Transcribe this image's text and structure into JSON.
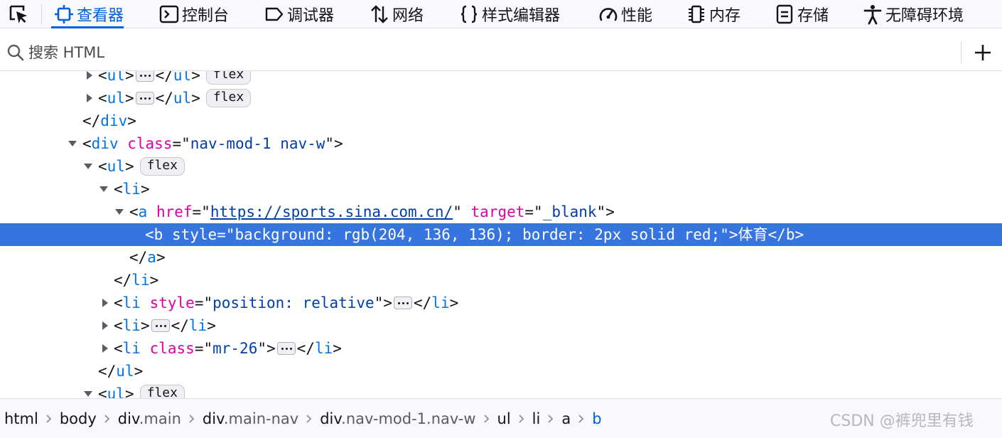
{
  "toolbar": {
    "tabs": [
      {
        "label": "查看器",
        "icon": "inspector-icon",
        "selected": true
      },
      {
        "label": "控制台",
        "icon": "console-icon"
      },
      {
        "label": "调试器",
        "icon": "debugger-icon"
      },
      {
        "label": "网络",
        "icon": "network-icon"
      },
      {
        "label": "样式编辑器",
        "icon": "style-editor-icon"
      },
      {
        "label": "性能",
        "icon": "performance-icon"
      },
      {
        "label": "内存",
        "icon": "memory-icon"
      },
      {
        "label": "存储",
        "icon": "storage-icon"
      },
      {
        "label": "无障碍环境",
        "icon": "accessibility-icon"
      }
    ]
  },
  "search": {
    "placeholder": "搜索 HTML"
  },
  "markup": {
    "badge_flex": "flex",
    "rows": [
      {
        "expanded": false,
        "parts": [
          "<",
          "ul",
          ">",
          "</",
          "ul",
          ">"
        ]
      },
      {
        "expanded": false,
        "parts": [
          "<",
          "ul",
          ">",
          "</",
          "ul",
          ">"
        ]
      },
      {
        "parts": [
          "</",
          "div",
          ">"
        ]
      },
      {
        "expanded": true,
        "parts": [
          "<",
          "div",
          "class",
          "=\"",
          "nav-mod-1 nav-w",
          "\">"
        ]
      },
      {
        "expanded": true,
        "parts": [
          "<",
          "ul",
          ">"
        ]
      },
      {
        "expanded": true,
        "parts": [
          "<",
          "li",
          ">"
        ]
      },
      {
        "expanded": true,
        "parts": [
          "<",
          "a",
          "href",
          "=\"",
          "https://sports.sina.com.cn/",
          "\"",
          "target",
          "=\"",
          "_blank",
          "\">"
        ]
      },
      {
        "selected": true,
        "parts": [
          "<",
          "b",
          "style",
          "=\"",
          "background: rgb(204, 136, 136); border: 2px solid red;",
          "\">",
          "体育",
          "</",
          "b",
          ">"
        ]
      },
      {
        "parts": [
          "</",
          "a",
          ">"
        ]
      },
      {
        "parts": [
          "</",
          "li",
          ">"
        ]
      },
      {
        "expanded": false,
        "parts": [
          "<",
          "li",
          "style",
          "=\"",
          "position: relative",
          "\">",
          "</",
          "li",
          ">"
        ]
      },
      {
        "expanded": false,
        "parts": [
          "<",
          "li",
          ">",
          "</",
          "li",
          ">"
        ]
      },
      {
        "expanded": false,
        "parts": [
          "<",
          "li",
          "class",
          "=\"",
          "mr-26",
          "\">",
          "</",
          "li",
          ">"
        ]
      },
      {
        "parts": [
          "</",
          "ul",
          ">"
        ]
      },
      {
        "expanded": true,
        "parts": [
          "<",
          "ul",
          ">"
        ]
      }
    ]
  },
  "breadcrumbs": [
    {
      "tag": "html"
    },
    {
      "tag": "body"
    },
    {
      "tag": "div",
      "cls": ".main"
    },
    {
      "tag": "div",
      "cls": ".main-nav"
    },
    {
      "tag": "div",
      "cls": ".nav-mod-1.nav-w"
    },
    {
      "tag": "ul"
    },
    {
      "tag": "li"
    },
    {
      "tag": "a"
    },
    {
      "tag": "b",
      "selected": true
    }
  ],
  "watermark": "CSDN @裤兜里有钱",
  "colors": {
    "accent": "#0061e0",
    "selection": "#3675e0",
    "tag": "#0074e8",
    "attr_name": "#dd00a9",
    "attr_value": "#003eaa"
  }
}
